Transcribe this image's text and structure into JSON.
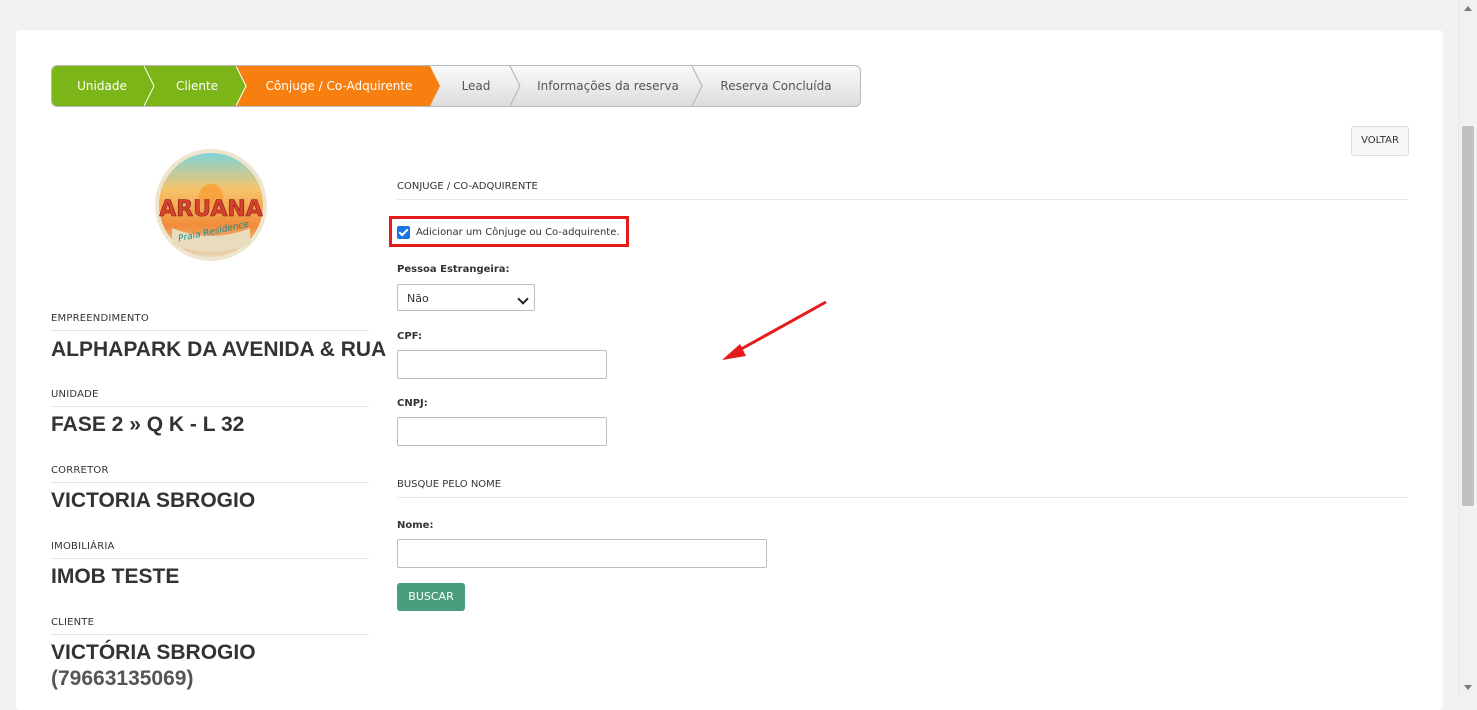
{
  "wizard": {
    "steps": [
      {
        "label": "Unidade",
        "state": "done"
      },
      {
        "label": "Cliente",
        "state": "done"
      },
      {
        "label": "Cônjuge / Co-Adquirente",
        "state": "active"
      },
      {
        "label": "Lead",
        "state": "pending"
      },
      {
        "label": "Informações da reserva",
        "state": "pending"
      },
      {
        "label": "Reserva Concluída",
        "state": "pending"
      }
    ],
    "colors": {
      "done": "#7cb518",
      "active": "#f77f10",
      "pending": "#e6e6e6"
    }
  },
  "sidebar": {
    "logo": {
      "brand": "ARUANA",
      "tagline": "Praia Residence"
    },
    "items": [
      {
        "label": "EMPREENDIMENTO",
        "value": "ALPHAPARK DA AVENIDA & RUA"
      },
      {
        "label": "UNIDADE",
        "value": "FASE 2 » Q K - L 32"
      },
      {
        "label": "CORRETOR",
        "value": "VICTORIA SBROGIO"
      },
      {
        "label": "IMOBILIÁRIA",
        "value": "IMOB TESTE"
      },
      {
        "label": "CLIENTE",
        "value": "VICTÓRIA SBROGIO",
        "sub": "(79663135069)"
      }
    ]
  },
  "main": {
    "back_label": "VOLTAR",
    "section1_title": "CONJUGE / CO-ADQUIRENTE",
    "checkbox_label": "Adicionar um Cônjuge ou Co-adquirente.",
    "checkbox_checked": true,
    "foreign_label": "Pessoa Estrangeira:",
    "foreign_value": "Não",
    "cpf_label": "CPF:",
    "cpf_value": "",
    "cnpj_label": "CNPJ:",
    "cnpj_value": "",
    "section2_title": "BUSQUE PELO NOME",
    "name_label": "Nome:",
    "name_value": "",
    "search_label": "BUSCAR"
  },
  "annotation": {
    "highlight_color": "#e31b1b"
  }
}
